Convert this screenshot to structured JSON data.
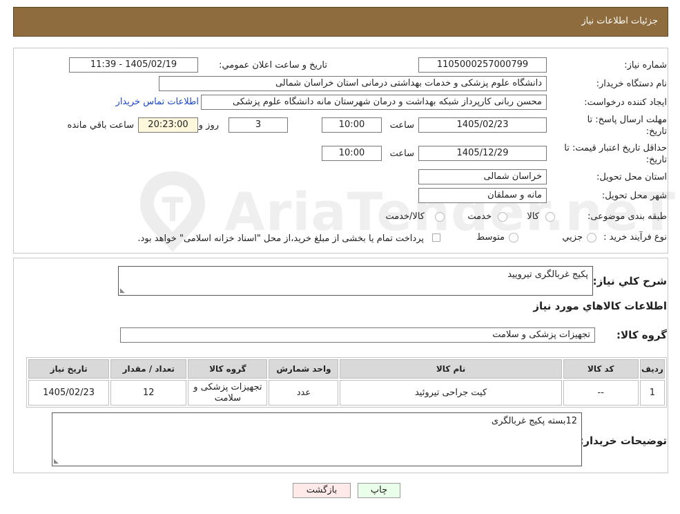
{
  "header": {
    "title": "جزئیات اطلاعات نیاز"
  },
  "watermark": {
    "text": "AriaTender.neT",
    "icon": "ariatender-logo-icon"
  },
  "fields": {
    "need_number": {
      "label": "شماره نیاز:",
      "value": "1105000257000799"
    },
    "announce": {
      "label": "تاریخ و ساعت اعلان عمومي:",
      "value": "1405/02/19 - 11:39"
    },
    "buyer": {
      "label": "نام دستگاه خریدار:",
      "value": "دانشگاه علوم پزشکی و خدمات بهداشتی درمانی استان خراسان شمالی"
    },
    "creator": {
      "label": "ایجاد کننده درخواست:",
      "value": "محسن ربانی کارپرداز شبکه بهداشت و درمان شهرستان مانه دانشگاه علوم پزشکی",
      "link": "اطلاعات تماس خریدار"
    },
    "deadline": {
      "label": "مهلت ارسال پاسخ: تا تاریخ:",
      "date": "1405/02/23",
      "time_label": "ساعت",
      "time": "10:00",
      "days": "3",
      "days_label": "روز و",
      "remaining": "20:23:00",
      "remaining_label": "ساعت باقي مانده"
    },
    "validity": {
      "label": "حداقل تاریخ اعتبار قیمت: تا تاریخ:",
      "date": "1405/12/29",
      "time_label": "ساعت",
      "time": "10:00"
    },
    "province": {
      "label": "استان محل تحویل:",
      "value": "خراسان شمالی"
    },
    "city": {
      "label": "شهر محل تحویل:",
      "value": "مانه و سملقان"
    },
    "category": {
      "label": "طبقه بندی موضوعی:",
      "options": [
        "کالا",
        "خدمت",
        "کالا/خدمت"
      ]
    },
    "process": {
      "label": "نوع فرآیند خرید :",
      "options": [
        "جزیي",
        "متوسط"
      ],
      "note": "پرداخت تمام یا بخشی از مبلغ خرید،از محل \"اسناد خزانه اسلامی\" خواهد بود."
    }
  },
  "summary": {
    "label": "شرح کلي نیاز:",
    "value": "پکیج غربالگری تیرویید"
  },
  "goods_info": {
    "title": "اطلاعات کالاهاي مورد نیاز"
  },
  "group": {
    "label": "گروه کالا:",
    "value": "تجهیزات پزشکی و سلامت"
  },
  "table": {
    "headers": [
      "ردیف",
      "کد کالا",
      "نام کالا",
      "واحد شمارش",
      "گروه کالا",
      "تعداد / مقدار",
      "تاریخ نیاز"
    ],
    "rows": [
      {
        "row": "1",
        "code": "--",
        "name": "کیت جراحی تیروئید",
        "unit": "عدد",
        "group": "تجهیزات پزشکی و سلامت",
        "qty": "12",
        "date": "1405/02/23"
      }
    ]
  },
  "buyer_notes": {
    "label": "توضیحات خریدار:",
    "value": "12بسته پکیج غربالگری"
  },
  "buttons": {
    "print": "چاپ",
    "back": "بازگشت"
  }
}
